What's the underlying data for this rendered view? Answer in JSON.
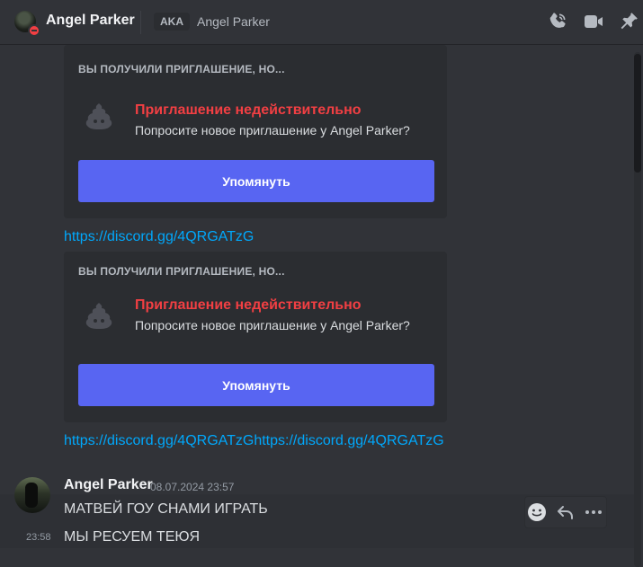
{
  "header": {
    "username": "Angel Parker",
    "aka_badge": "AKA",
    "aka_name": "Angel Parker",
    "icons": [
      "voice-call-icon",
      "video-call-icon",
      "pin-icon"
    ],
    "status_color": "#f23f43"
  },
  "invites": [
    {
      "title": "ВЫ ПОЛУЧИЛИ ПРИГЛАШЕНИЕ, НО...",
      "heading": "Приглашение недействительно",
      "subtitle": "Попросите новое приглашение у Angel Parker?",
      "button": "Упомянуть"
    },
    {
      "title": "ВЫ ПОЛУЧИЛИ ПРИГЛАШЕНИЕ, НО...",
      "heading": "Приглашение недействительно",
      "subtitle": "Попросите новое приглашение у Angel Parker?",
      "button": "Упомянуть"
    }
  ],
  "links": [
    "https://discord.gg/4QRGATzG",
    "https://discord.gg/4QRGATzGhttps://discord.gg/4QRGATzG"
  ],
  "message": {
    "author": "Angel Parker",
    "timestamp": "08.07.2024 23:57",
    "line1": "МАТВЕЙ ГОУ СНАМИ ИГРАТЬ",
    "line2_time": "23:58",
    "line2": "МЫ РЕСУЕМ ТЕЮЯ"
  },
  "toolbar_icons": [
    "add-reaction-icon",
    "reply-icon",
    "more-icon"
  ],
  "colors": {
    "accent": "#5865f2",
    "link": "#00a8fc",
    "error": "#f23f43"
  }
}
